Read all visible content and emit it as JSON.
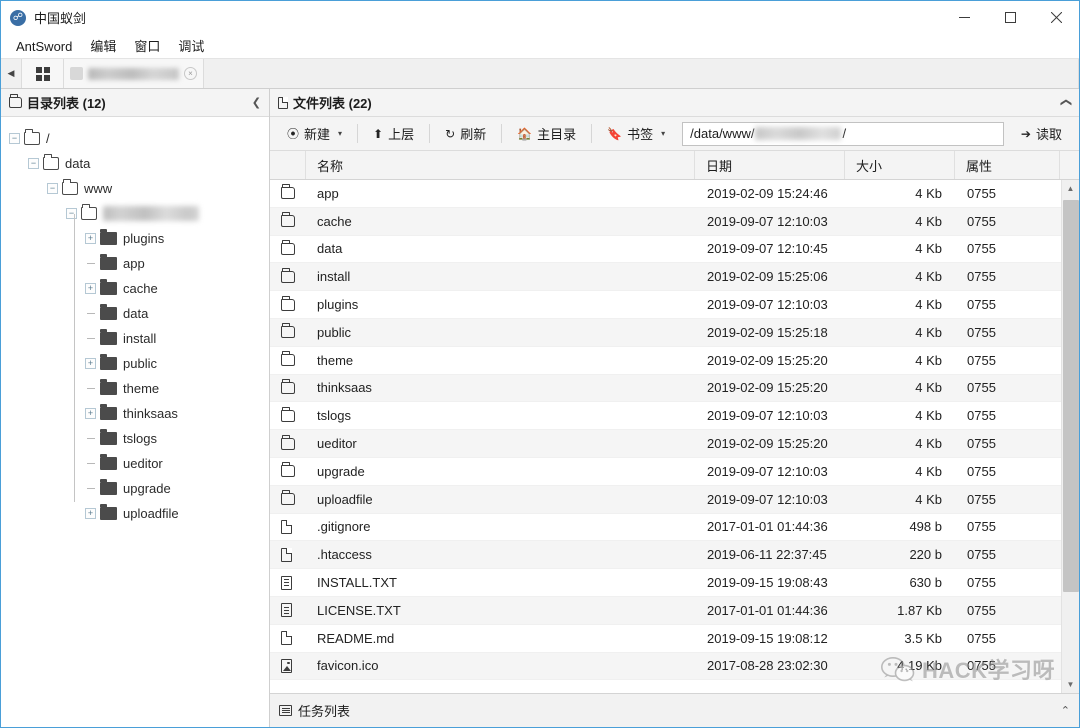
{
  "window": {
    "title": "中国蚁剑",
    "app_icon": "antsword-logo-icon",
    "controls": {
      "minimize": "−",
      "maximize": "□",
      "close": "✕"
    }
  },
  "menubar": {
    "items": [
      {
        "label": "AntSword"
      },
      {
        "label": "编辑"
      },
      {
        "label": "窗口"
      },
      {
        "label": "调试"
      }
    ]
  },
  "tabstrip": {
    "nav_back": "◀",
    "grid_button": "grid-view-icon",
    "tab": {
      "title_redacted": true,
      "close": "×"
    }
  },
  "dir_panel": {
    "title": "目录列表 (12)",
    "collapse": "❮",
    "tree": [
      {
        "label": "/",
        "depth": 0,
        "expander": "−",
        "icon": "folder-outline",
        "redacted": false
      },
      {
        "label": "data",
        "depth": 1,
        "expander": "−",
        "icon": "folder-outline",
        "redacted": false
      },
      {
        "label": "www",
        "depth": 2,
        "expander": "−",
        "icon": "folder-outline",
        "redacted": false
      },
      {
        "label": "",
        "depth": 3,
        "expander": "−",
        "icon": "folder-outline",
        "redacted": true
      },
      {
        "label": "plugins",
        "depth": 4,
        "expander": "+",
        "icon": "folder-solid",
        "redacted": false
      },
      {
        "label": "app",
        "depth": 4,
        "expander": "",
        "icon": "folder-solid",
        "redacted": false
      },
      {
        "label": "cache",
        "depth": 4,
        "expander": "+",
        "icon": "folder-solid",
        "redacted": false
      },
      {
        "label": "data",
        "depth": 4,
        "expander": "",
        "icon": "folder-solid",
        "redacted": false
      },
      {
        "label": "install",
        "depth": 4,
        "expander": "",
        "icon": "folder-solid",
        "redacted": false
      },
      {
        "label": "public",
        "depth": 4,
        "expander": "+",
        "icon": "folder-solid",
        "redacted": false
      },
      {
        "label": "theme",
        "depth": 4,
        "expander": "",
        "icon": "folder-solid",
        "redacted": false
      },
      {
        "label": "thinksaas",
        "depth": 4,
        "expander": "+",
        "icon": "folder-solid",
        "redacted": false
      },
      {
        "label": "tslogs",
        "depth": 4,
        "expander": "",
        "icon": "folder-solid",
        "redacted": false
      },
      {
        "label": "ueditor",
        "depth": 4,
        "expander": "",
        "icon": "folder-solid",
        "redacted": false
      },
      {
        "label": "upgrade",
        "depth": 4,
        "expander": "",
        "icon": "folder-solid",
        "redacted": false
      },
      {
        "label": "uploadfile",
        "depth": 4,
        "expander": "+",
        "icon": "folder-solid",
        "redacted": false
      }
    ]
  },
  "file_panel": {
    "title": "文件列表 (22)",
    "collapse": "❮",
    "toolbar": {
      "new": {
        "label": "新建",
        "icon": "plus-circle-icon",
        "has_caret": true
      },
      "up": {
        "label": "上层",
        "icon": "arrow-up-icon"
      },
      "refresh": {
        "label": "刷新",
        "icon": "refresh-icon"
      },
      "home": {
        "label": "主目录",
        "icon": "home-icon"
      },
      "bookmark": {
        "label": "书签",
        "icon": "bookmark-icon",
        "has_caret": true
      },
      "read": {
        "label": "读取",
        "icon": "arrow-right-icon"
      },
      "caret": "▾"
    },
    "path": {
      "prefix": "/data/www/",
      "redacted": true,
      "suffix": "/"
    },
    "columns": [
      {
        "key": "name",
        "label": "名称"
      },
      {
        "key": "date",
        "label": "日期"
      },
      {
        "key": "size",
        "label": "大小"
      },
      {
        "key": "attr",
        "label": "属性"
      }
    ],
    "rows": [
      {
        "icon": "folder",
        "name": "app",
        "date": "2019-02-09 15:24:46",
        "size": "4 Kb",
        "attr": "0755"
      },
      {
        "icon": "folder",
        "name": "cache",
        "date": "2019-09-07 12:10:03",
        "size": "4 Kb",
        "attr": "0755"
      },
      {
        "icon": "folder",
        "name": "data",
        "date": "2019-09-07 12:10:45",
        "size": "4 Kb",
        "attr": "0755"
      },
      {
        "icon": "folder",
        "name": "install",
        "date": "2019-02-09 15:25:06",
        "size": "4 Kb",
        "attr": "0755"
      },
      {
        "icon": "folder",
        "name": "plugins",
        "date": "2019-09-07 12:10:03",
        "size": "4 Kb",
        "attr": "0755"
      },
      {
        "icon": "folder",
        "name": "public",
        "date": "2019-02-09 15:25:18",
        "size": "4 Kb",
        "attr": "0755"
      },
      {
        "icon": "folder",
        "name": "theme",
        "date": "2019-02-09 15:25:20",
        "size": "4 Kb",
        "attr": "0755"
      },
      {
        "icon": "folder",
        "name": "thinksaas",
        "date": "2019-02-09 15:25:20",
        "size": "4 Kb",
        "attr": "0755"
      },
      {
        "icon": "folder",
        "name": "tslogs",
        "date": "2019-09-07 12:10:03",
        "size": "4 Kb",
        "attr": "0755"
      },
      {
        "icon": "folder",
        "name": "ueditor",
        "date": "2019-02-09 15:25:20",
        "size": "4 Kb",
        "attr": "0755"
      },
      {
        "icon": "folder",
        "name": "upgrade",
        "date": "2019-09-07 12:10:03",
        "size": "4 Kb",
        "attr": "0755"
      },
      {
        "icon": "folder",
        "name": "uploadfile",
        "date": "2019-09-07 12:10:03",
        "size": "4 Kb",
        "attr": "0755"
      },
      {
        "icon": "file",
        "name": ".gitignore",
        "date": "2017-01-01 01:44:36",
        "size": "498 b",
        "attr": "0755"
      },
      {
        "icon": "file",
        "name": ".htaccess",
        "date": "2019-06-11 22:37:45",
        "size": "220 b",
        "attr": "0755"
      },
      {
        "icon": "text",
        "name": "INSTALL.TXT",
        "date": "2019-09-15 19:08:43",
        "size": "630 b",
        "attr": "0755"
      },
      {
        "icon": "text",
        "name": "LICENSE.TXT",
        "date": "2017-01-01 01:44:36",
        "size": "1.87 Kb",
        "attr": "0755"
      },
      {
        "icon": "file",
        "name": "README.md",
        "date": "2019-09-15 19:08:12",
        "size": "3.5 Kb",
        "attr": "0755"
      },
      {
        "icon": "image",
        "name": "favicon.ico",
        "date": "2017-08-28 23:02:30",
        "size": "4.19 Kb",
        "attr": "0755"
      }
    ],
    "scrollbar": {
      "up": "▲",
      "down": "▼"
    }
  },
  "watermark": {
    "text": "HACK学习呀",
    "logo": "wechat-icon"
  },
  "footer": {
    "label": "任务列表",
    "icon": "task-list-icon",
    "chevron": "⌃"
  },
  "colors": {
    "window_border": "#4a9fd8",
    "toolbar_bg": "#f4f4f4",
    "row_alt": "#f5f5f5",
    "accent": "#3a6ea5"
  }
}
